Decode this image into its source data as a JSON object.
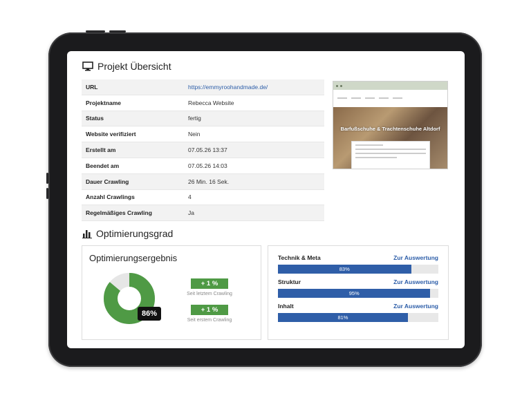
{
  "overview": {
    "title": "Projekt Übersicht",
    "rows": [
      {
        "label": "URL",
        "value": "https://emmyroohandmade.de/"
      },
      {
        "label": "Projektname",
        "value": "Rebecca Website"
      },
      {
        "label": "Status",
        "value": "fertig"
      },
      {
        "label": "Website verifiziert",
        "value": "Nein"
      },
      {
        "label": "Erstellt am",
        "value": "07.05.26 13:37"
      },
      {
        "label": "Beendet am",
        "value": "07.05.26 14:03"
      },
      {
        "label": "Dauer Crawling",
        "value": "26 Min. 16 Sek."
      },
      {
        "label": "Anzahl Crawlings",
        "value": "4"
      },
      {
        "label": "Regelmäßiges Crawling",
        "value": "Ja"
      }
    ],
    "preview": {
      "hero_text": "Barfußschuhe & Trachtenschuhe Altdorf"
    }
  },
  "optimization": {
    "title": "Optimierungsgrad",
    "result": {
      "title": "Optimierungsergebnis",
      "percent_label": "86%",
      "percent": 86,
      "change_last": "+ 1 %",
      "change_last_label": "Seit letztem Crawling",
      "change_first": "+ 1 %",
      "change_first_label": "Seit erstem Crawling"
    },
    "metrics": [
      {
        "name": "Technik & Meta",
        "link": "Zur Auswertung",
        "value": 83,
        "label": "83%"
      },
      {
        "name": "Struktur",
        "link": "Zur Auswertung",
        "value": 95,
        "label": "95%"
      },
      {
        "name": "Inhalt",
        "link": "Zur Auswertung",
        "value": 81,
        "label": "81%"
      }
    ]
  },
  "colors": {
    "green": "#4f9a45",
    "blue": "#2f5ea8",
    "link": "#2c5da8"
  }
}
